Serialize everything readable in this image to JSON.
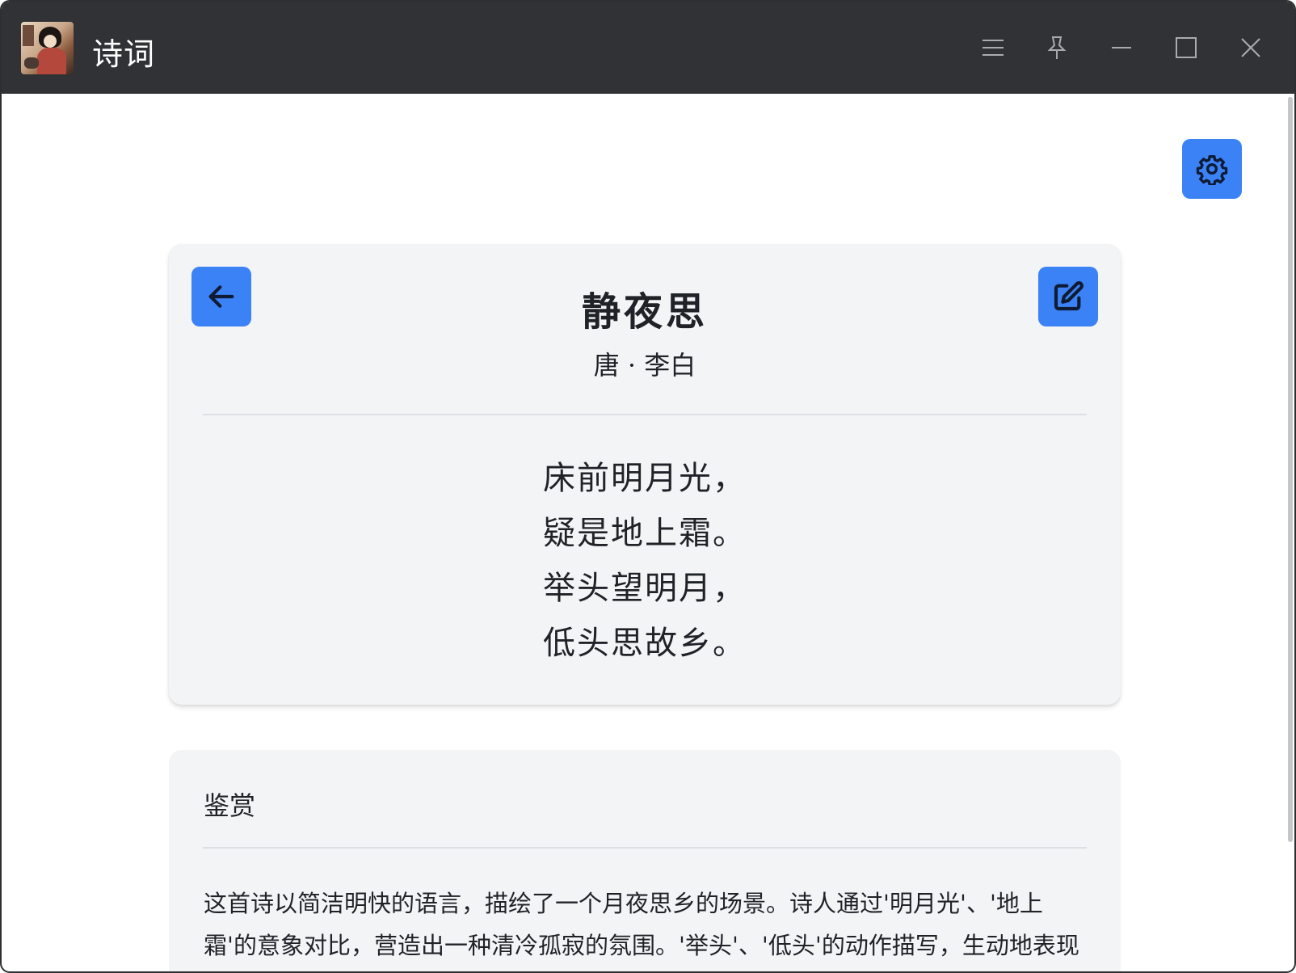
{
  "window": {
    "title": "诗词",
    "controls": {
      "menu": "menu-icon",
      "pin": "pin-icon",
      "minimize": "minimize-icon",
      "maximize": "maximize-icon",
      "close": "close-icon"
    }
  },
  "toolbar": {
    "settings_icon": "gear-icon"
  },
  "poem": {
    "title": "静夜思",
    "author": "唐 · 李白",
    "lines": [
      "床前明月光，",
      "疑是地上霜。",
      "举头望明月，",
      "低头思故乡。"
    ],
    "back_icon": "arrow-left-icon",
    "edit_icon": "edit-icon"
  },
  "appreciation": {
    "heading": "鉴赏",
    "text": "这首诗以简洁明快的语言，描绘了一个月夜思乡的场景。诗人通过'明月光'、'地上霜'的意象对比，营造出一种清冷孤寂的氛围。'举头'、'低头'的动作描写，生动地表现了诗人由望月而思乡的心理变化，表达了诗人深切的思乡之情。"
  },
  "colors": {
    "titlebar": "#303235",
    "accent": "#3b82f6",
    "card": "#f3f4f6"
  }
}
